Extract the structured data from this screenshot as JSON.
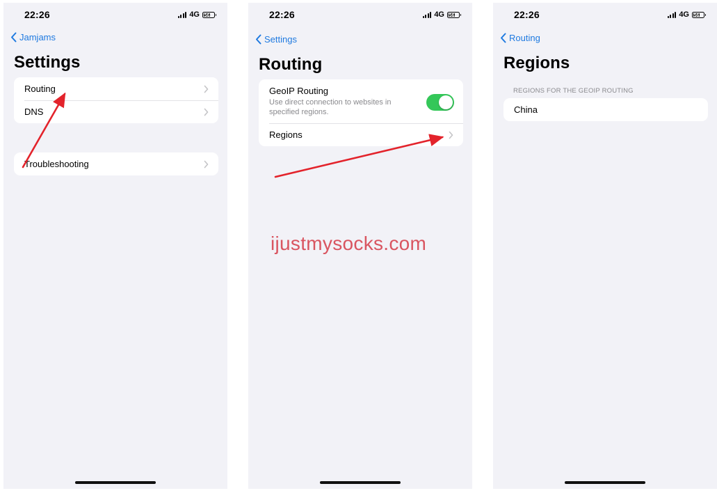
{
  "status_bar": {
    "time": "22:26",
    "network": "4G",
    "battery": "56"
  },
  "screens": [
    {
      "back_label": "Jamjams",
      "title": "Settings",
      "groups": [
        {
          "rows": [
            {
              "label": "Routing"
            },
            {
              "label": "DNS"
            }
          ]
        },
        {
          "rows": [
            {
              "label": "Troubleshooting"
            }
          ]
        }
      ]
    },
    {
      "back_label": "Settings",
      "title": "Routing",
      "geoip": {
        "label": "GeoIP Routing",
        "description": "Use direct connection to websites in specified regions.",
        "enabled": true
      },
      "regions_label": "Regions"
    },
    {
      "back_label": "Routing",
      "title": "Regions",
      "section_header": "REGIONS FOR THE GEOIP ROUTING",
      "rows": [
        {
          "label": "China"
        }
      ]
    }
  ],
  "watermark": "ijustmysocks.com",
  "colors": {
    "accent": "#1f7ae0",
    "toggle_on": "#34c759",
    "arrow": "#e3232b",
    "watermark": "#d95560"
  }
}
